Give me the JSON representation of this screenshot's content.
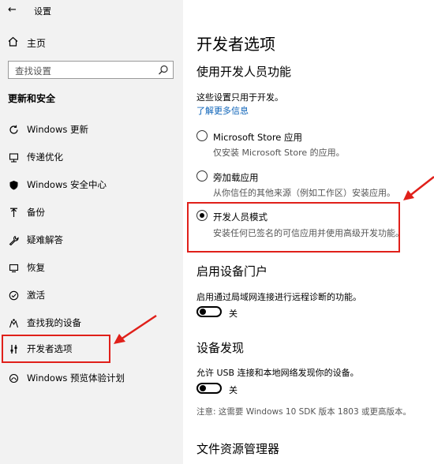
{
  "window": {
    "title": "设置"
  },
  "sidebar": {
    "home_label": "主页",
    "search_placeholder": "查找设置",
    "section_title": "更新和安全",
    "items": [
      {
        "label": "Windows 更新",
        "icon": "sync-icon"
      },
      {
        "label": "传递优化",
        "icon": "delivery-optimization-icon"
      },
      {
        "label": "Windows 安全中心",
        "icon": "shield-icon"
      },
      {
        "label": "备份",
        "icon": "backup-icon"
      },
      {
        "label": "疑难解答",
        "icon": "wrench-icon"
      },
      {
        "label": "恢复",
        "icon": "recovery-icon"
      },
      {
        "label": "激活",
        "icon": "activation-icon"
      },
      {
        "label": "查找我的设备",
        "icon": "find-device-icon"
      },
      {
        "label": "开发者选项",
        "icon": "developer-icon",
        "selected": true
      },
      {
        "label": "Windows 预览体验计划",
        "icon": "insider-icon"
      }
    ]
  },
  "main": {
    "title": "开发者选项",
    "dev_features": {
      "heading": "使用开发人员功能",
      "desc": "这些设置只用于开发。",
      "link": "了解更多信息",
      "options": [
        {
          "label": "Microsoft Store 应用",
          "desc": "仅安装 Microsoft Store 的应用。",
          "checked": false
        },
        {
          "label": "旁加载应用",
          "desc": "从你信任的其他来源（例如工作区）安装应用。",
          "checked": false
        },
        {
          "label": "开发人员模式",
          "desc": "安装任何已签名的可信应用并使用高级开发功能。",
          "checked": true
        }
      ]
    },
    "device_portal": {
      "heading": "启用设备门户",
      "desc": "启用通过局域网连接进行远程诊断的功能。",
      "toggle_label": "关"
    },
    "device_discovery": {
      "heading": "设备发现",
      "desc": "允许 USB 连接和本地网络发现你的设备。",
      "toggle_label": "关",
      "note": "注意: 这需要 Windows 10 SDK 版本 1803 或更高版本。"
    },
    "file_explorer": {
      "heading": "文件资源管理器"
    }
  },
  "colors": {
    "accent_link": "#0b62b8",
    "highlight": "#e0201a",
    "sidebar_bg": "#f2f2f2"
  }
}
